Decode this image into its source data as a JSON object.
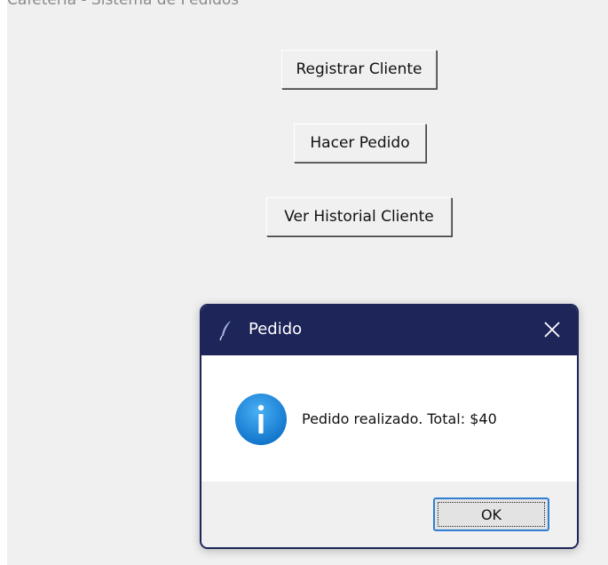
{
  "main_window": {
    "title": "Cafetería - Sistema de Pedidos",
    "buttons": {
      "registrar_cliente": "Registrar Cliente",
      "hacer_pedido": "Hacer Pedido",
      "ver_historial": "Ver Historial Cliente"
    }
  },
  "dialog": {
    "title": "Pedido",
    "title_icon": "feather-icon",
    "close_icon": "close-icon",
    "message_icon": "info-icon",
    "message": "Pedido realizado. Total: $40",
    "ok_label": "OK"
  },
  "colors": {
    "dialog_titlebar": "#1d2559",
    "info_icon": "#1a7fd8",
    "window_background": "#f0f0f0"
  }
}
